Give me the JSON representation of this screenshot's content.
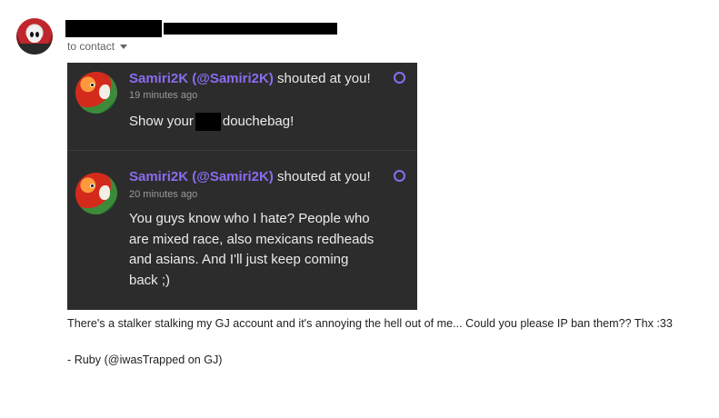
{
  "email": {
    "to_label": "to contact"
  },
  "shouts": [
    {
      "user": "Samiri2K (@Samiri2K)",
      "action": "shouted at you!",
      "time": "19 minutes ago",
      "text_before": "Show your",
      "text_after": "douchebag!"
    },
    {
      "user": "Samiri2K (@Samiri2K)",
      "action": "shouted at you!",
      "time": "20 minutes ago",
      "text": "You guys know who I hate? People who are mixed race, also mexicans redheads and asians. And I'll just keep coming back ;)"
    }
  ],
  "message": "There's a stalker stalking my GJ account and it's annoying the hell out of me... Could you please IP ban them?? Thx :33",
  "signature": "- Ruby (@iwasTrapped on GJ)",
  "colors": {
    "accent": "#8a6cf0",
    "panel": "#2c2c2c"
  }
}
